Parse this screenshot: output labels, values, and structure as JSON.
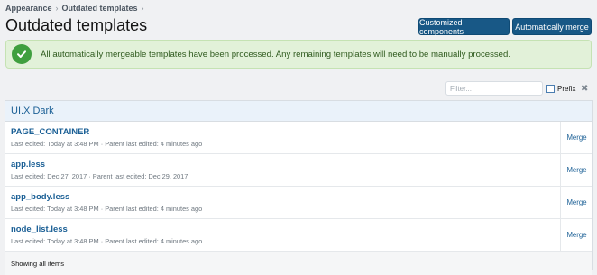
{
  "breadcrumb": [
    "Appearance",
    "Outdated templates"
  ],
  "page_title": "Outdated templates",
  "buttons": {
    "customized": "Customized components",
    "automerge": "Automatically merge"
  },
  "notice": {
    "message": "All automatically mergeable templates have been processed. Any remaining templates will need to be manually processed.",
    "icon": "check-circle-icon",
    "color": "#3f9f3f"
  },
  "filter": {
    "placeholder": "Filter...",
    "prefix_label": "Prefix",
    "clear_icon": "close-icon"
  },
  "style": {
    "group": "UI.X Dark"
  },
  "templates": [
    {
      "name": "PAGE_CONTAINER",
      "meta": "Last edited: Today at 3:48 PM · Parent last edited: 4 minutes ago",
      "action": "Merge"
    },
    {
      "name": "app.less",
      "meta": "Last edited: Dec 27, 2017 · Parent last edited: Dec 29, 2017",
      "action": "Merge"
    },
    {
      "name": "app_body.less",
      "meta": "Last edited: Today at 3:48 PM · Parent last edited: 4 minutes ago",
      "action": "Merge"
    },
    {
      "name": "node_list.less",
      "meta": "Last edited: Today at 3:48 PM · Parent last edited: 4 minutes ago",
      "action": "Merge"
    }
  ],
  "footer": "Showing all items",
  "colors": {
    "accent": "#185886",
    "link": "#1a5f95",
    "success_bg": "#e2f1d9"
  }
}
